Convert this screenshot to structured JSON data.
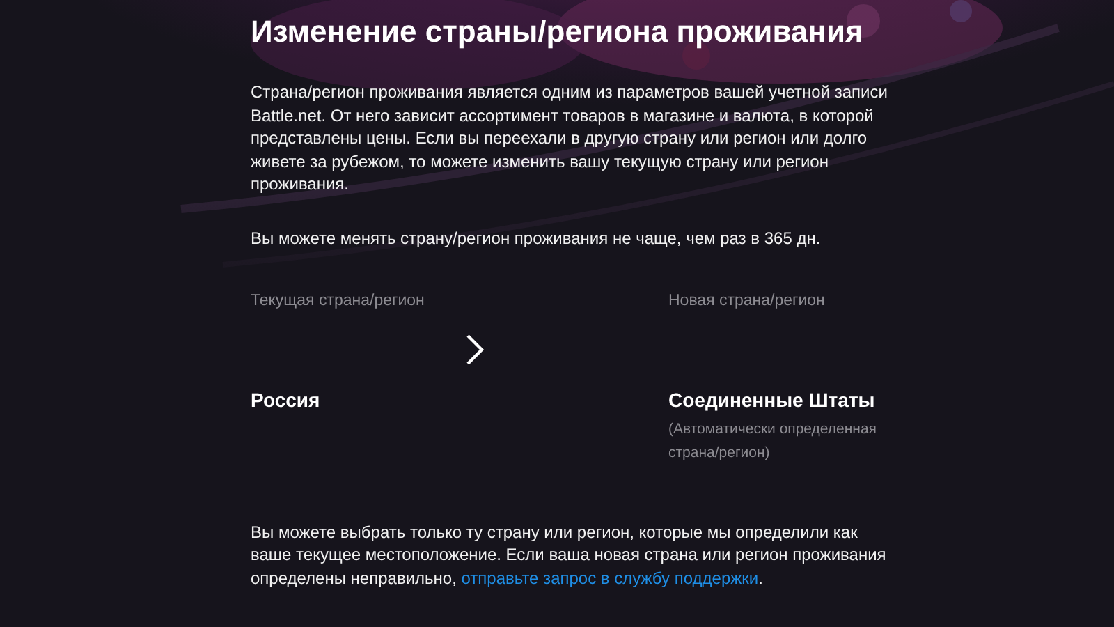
{
  "title": "Изменение страны/региона проживания",
  "intro": "Страна/регион проживания является одним из параметров вашей учетной записи Battle.net. От него зависит ассортимент товаров в магазине и валюта, в которой представлены цены. Если вы переехали в другую страну или регион или долго живете за рубежом, то можете изменить вашу текущую страну или регион проживания.",
  "limit": "Вы можете менять страну/регион проживания не чаще, чем раз в 365 дн.",
  "current": {
    "label": "Текущая страна/регион",
    "value": "Россия"
  },
  "new": {
    "label": "Новая страна/регион",
    "value": "Соединенные Штаты",
    "note": "(Автоматически определенная страна/регион)"
  },
  "footer": {
    "text": "Вы можете выбрать только ту страну или регион, которые мы определили как ваше текущее местоположение. Если ваша новая страна или регион проживания определены неправильно,",
    "link": "отправьте запрос в службу поддержки",
    "end": "."
  }
}
